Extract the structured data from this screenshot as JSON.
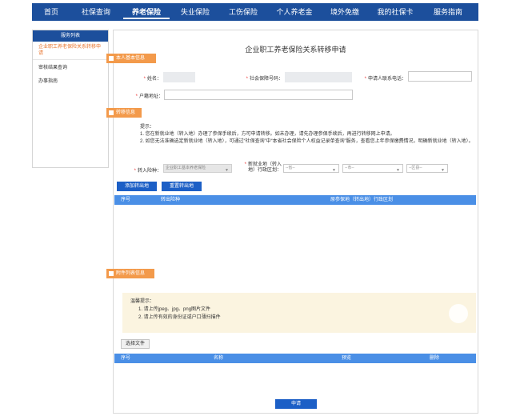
{
  "nav": [
    {
      "label": "首页"
    },
    {
      "label": "社保查询"
    },
    {
      "label": "养老保险"
    },
    {
      "label": "失业保险"
    },
    {
      "label": "工伤保险"
    },
    {
      "label": "个人养老金"
    },
    {
      "label": "境外免缴"
    },
    {
      "label": "我的社保卡"
    },
    {
      "label": "服务指南"
    }
  ],
  "sidebar": {
    "title": "服务列表",
    "items": [
      {
        "label": "企业职工养老保险关系转移申请"
      },
      {
        "label": "审核结果查询"
      },
      {
        "label": "办事指南"
      }
    ]
  },
  "page": {
    "title": "企业职工养老保险关系转移申请",
    "section_basic": "本人基本信息",
    "section_transfer": "转移信息",
    "section_attach": "附件列表信息"
  },
  "form": {
    "name_label": "姓名：",
    "ssn_label": "社会保障号码：",
    "phone_label": "申请人联系电话：",
    "address_label": "户籍地址：",
    "transfer_type_label": "转入险种：",
    "transfer_type_value": "企业职工基本养老保险",
    "region_label": "新就业地（转入地）行政区划：",
    "province_placeholder": "--省--",
    "city_placeholder": "--市--",
    "district_placeholder": "--区县--"
  },
  "tips": {
    "heading": "提示：",
    "line1": "1. 您在新就业地（转入地）办理了参保手续后，方可申请转移。如未办理，请先办理参保手续后，再进行转移网上申请。",
    "line2": "2. 如您无法准确选定新就业地（转入地），可通过“社保查询”中“本省社会保险个人权益记录单查询”服务，查看您上年参保缴费情况，明确新就业地（转入地）。"
  },
  "buttons": {
    "add_out": "添加转出地",
    "reset_out": "重置转出地",
    "choose_file": "选择文件",
    "submit": "申请"
  },
  "table1": {
    "headers": [
      "序号",
      "转出险种",
      "原参保地（转出地）行政区划"
    ]
  },
  "notice": {
    "title": "温馨提示：",
    "line1": "1. 请上传jpeg、jpg、png图片文件",
    "line2": "2. 请上传有效的身份证或户口薄扫描件"
  },
  "table2": {
    "headers": [
      "序号",
      "名称",
      "预览",
      "删除"
    ]
  },
  "colors": {
    "nav_bg": "#1c4f9c",
    "accent_orange": "#f39a4b",
    "button_blue": "#1c5fc6",
    "table_head": "#4a8fe6"
  }
}
